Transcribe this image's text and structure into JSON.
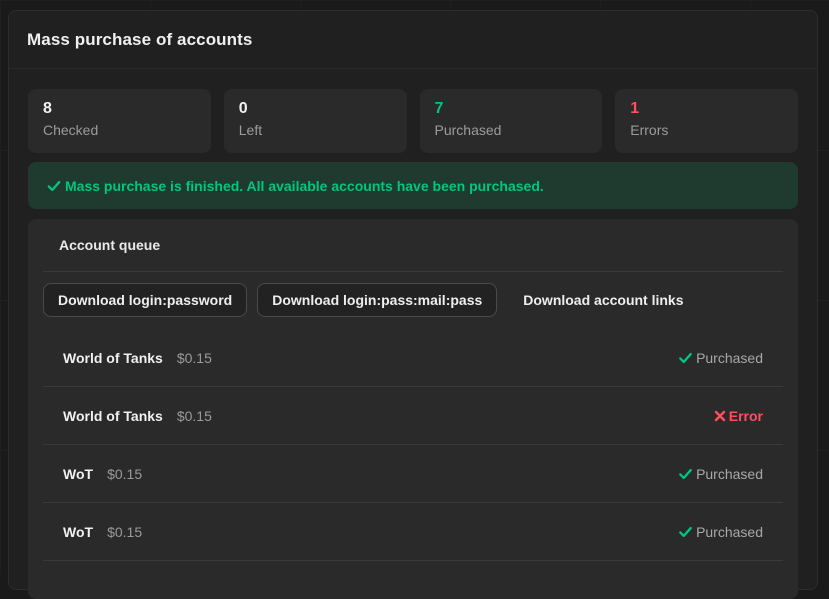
{
  "modal": {
    "title": "Mass purchase of accounts"
  },
  "stats": [
    {
      "value": "8",
      "label": "Checked",
      "color": "#f2f2f2"
    },
    {
      "value": "0",
      "label": "Left",
      "color": "#f2f2f2"
    },
    {
      "value": "7",
      "label": "Purchased",
      "color": "#00c77f"
    },
    {
      "value": "1",
      "label": "Errors",
      "color": "#ff4f5e"
    }
  ],
  "alert": {
    "icon": "check-icon",
    "text": "Mass purchase is finished. All available accounts have been purchased.",
    "color": "#00c77f"
  },
  "queue": {
    "title": "Account queue",
    "downloads": {
      "login_password": "Download login:password",
      "login_pass_mail_pass": "Download login:pass:mail:pass",
      "account_links": "Download account links"
    },
    "rows": [
      {
        "name": "World of Tanks",
        "price": "$0.15",
        "status": "Purchased",
        "status_type": "ok",
        "icon": "check-icon"
      },
      {
        "name": "World of Tanks",
        "price": "$0.15",
        "status": "Error",
        "status_type": "err",
        "icon": "x-icon"
      },
      {
        "name": "WoT",
        "price": "$0.15",
        "status": "Purchased",
        "status_type": "ok",
        "icon": "check-icon"
      },
      {
        "name": "WoT",
        "price": "$0.15",
        "status": "Purchased",
        "status_type": "ok",
        "icon": "check-icon"
      }
    ]
  }
}
